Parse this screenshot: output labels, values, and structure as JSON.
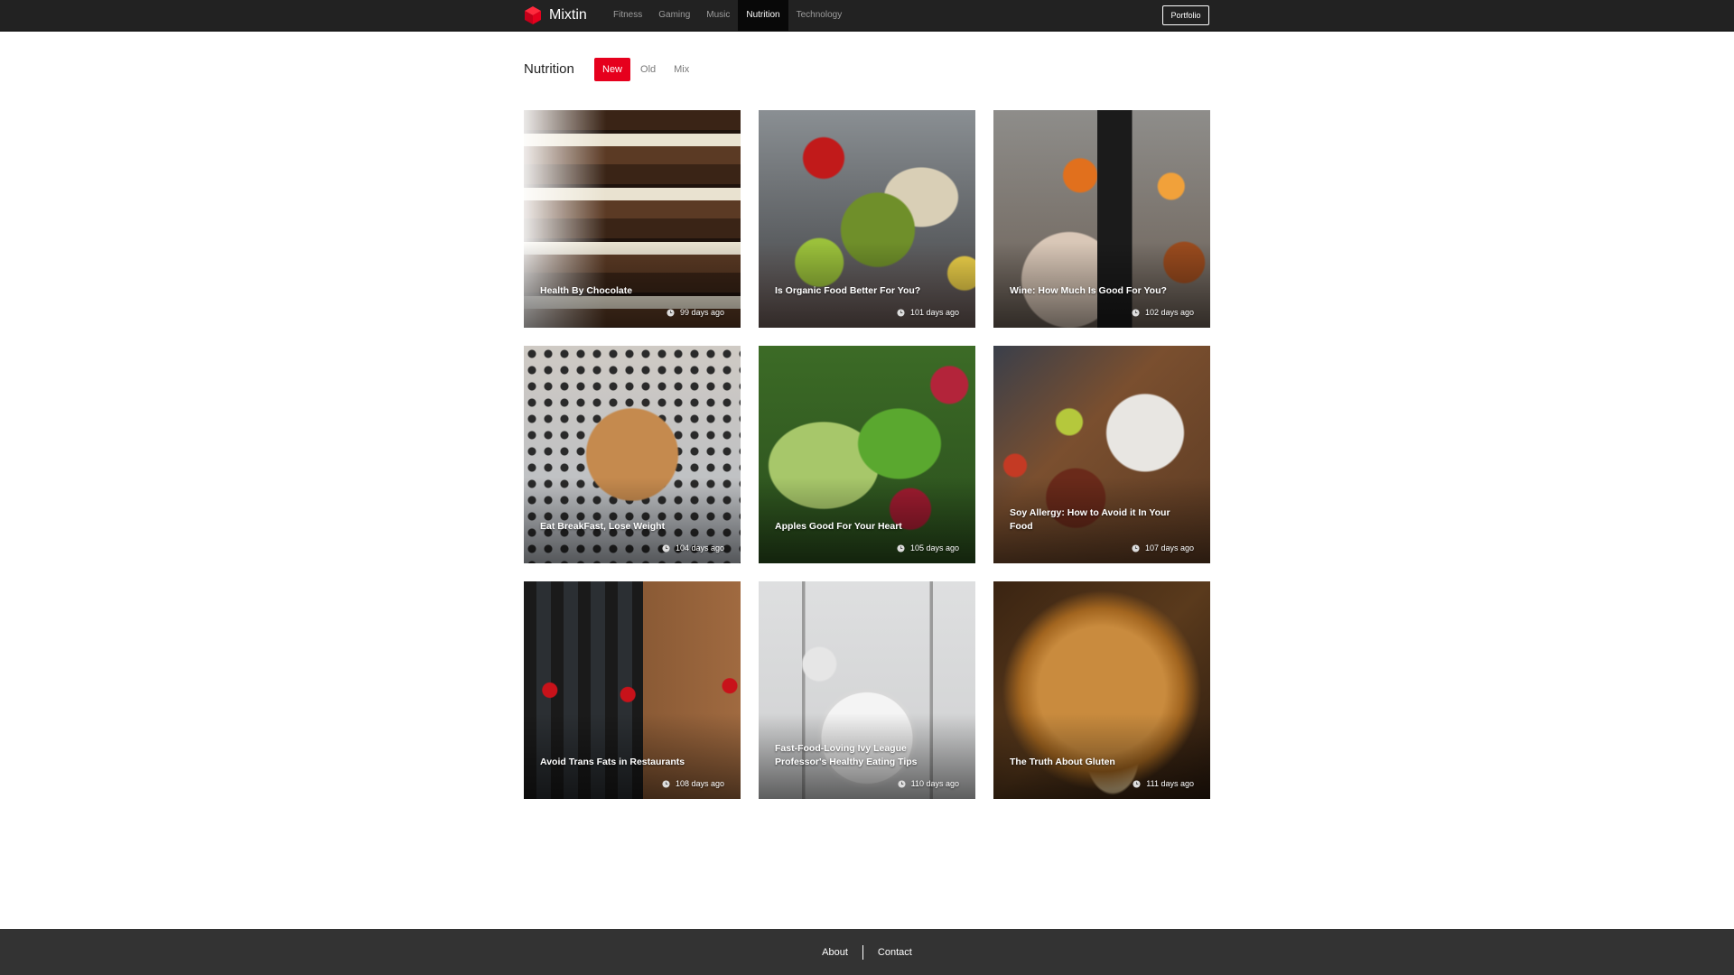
{
  "navbar": {
    "brand": "Mixtin",
    "brand_icon": "cube-logo-icon",
    "links": [
      {
        "label": "Fitness",
        "active": false
      },
      {
        "label": "Gaming",
        "active": false
      },
      {
        "label": "Music",
        "active": false
      },
      {
        "label": "Nutrition",
        "active": true
      },
      {
        "label": "Technology",
        "active": false
      }
    ],
    "portfolio_label": "Portfolio"
  },
  "section": {
    "title": "Nutrition",
    "filters": [
      {
        "label": "New",
        "active": true
      },
      {
        "label": "Old",
        "active": false
      },
      {
        "label": "Mix",
        "active": false
      }
    ]
  },
  "posts": [
    {
      "title": "Health By Chocolate",
      "age": "99 days ago"
    },
    {
      "title": "Is Organic Food Better For You?",
      "age": "101 days ago"
    },
    {
      "title": "Wine: How Much Is Good For You?",
      "age": "102 days ago"
    },
    {
      "title": "Eat BreakFast, Lose Weight",
      "age": "104 days ago"
    },
    {
      "title": "Apples Good For Your Heart",
      "age": "105 days ago"
    },
    {
      "title": "Soy Allergy: How to Avoid it In Your Food",
      "age": "107 days ago"
    },
    {
      "title": "Avoid Trans Fats in Restaurants",
      "age": "108 days ago"
    },
    {
      "title": "Fast-Food-Loving Ivy League Professor's Healthy Eating Tips",
      "age": "110 days ago"
    },
    {
      "title": "The Truth About Gluten",
      "age": "111 days ago"
    }
  ],
  "footer": {
    "links": [
      "About",
      "Contact"
    ]
  },
  "colors": {
    "accent": "#e6001d",
    "navbar": "#222222",
    "footer": "#333333"
  }
}
